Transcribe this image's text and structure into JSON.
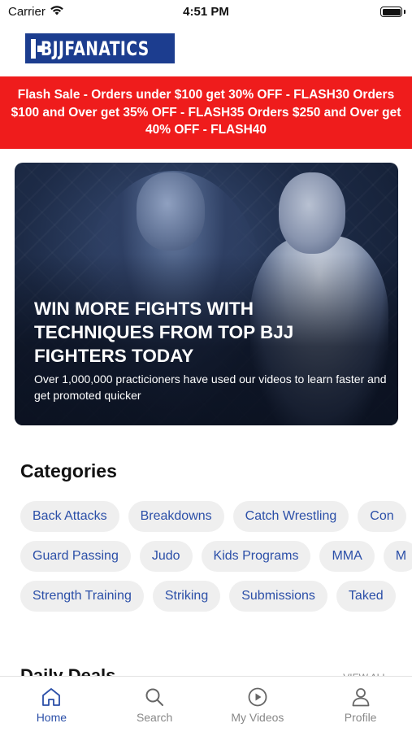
{
  "status_bar": {
    "carrier": "Carrier",
    "time": "4:51 PM"
  },
  "header": {
    "logo_text": "BJJFANATICS"
  },
  "flash_banner": {
    "text": "Flash Sale - Orders under $100 get 30% OFF - FLASH30 Orders $100 and Over get 35% OFF - FLASH35 Orders $250 and Over get 40% OFF - FLASH40"
  },
  "hero": {
    "title": "WIN MORE FIGHTS WITH TECHNIQUES FROM TOP BJJ FIGHTERS TODAY",
    "subtitle": "Over 1,000,000 practicioners have used our videos to learn faster and get promoted quicker"
  },
  "categories": {
    "title": "Categories",
    "rows": [
      [
        "Back Attacks",
        "Breakdowns",
        "Catch Wrestling",
        "Con"
      ],
      [
        "Guard Passing",
        "Judo",
        "Kids Programs",
        "MMA",
        "M"
      ],
      [
        "Strength Training",
        "Striking",
        "Submissions",
        "Taked"
      ]
    ]
  },
  "deals": {
    "title": "Daily Deals",
    "link": "VIEW ALL"
  },
  "tab_bar": {
    "items": [
      {
        "label": "Home",
        "icon": "home-icon",
        "active": true
      },
      {
        "label": "Search",
        "icon": "search-icon",
        "active": false
      },
      {
        "label": "My Videos",
        "icon": "play-circle-icon",
        "active": false
      },
      {
        "label": "Profile",
        "icon": "user-icon",
        "active": false
      }
    ]
  },
  "colors": {
    "brand_blue": "#1c3d8f",
    "accent_blue": "#2b4fa8",
    "flash_red": "#ef1c1c"
  }
}
